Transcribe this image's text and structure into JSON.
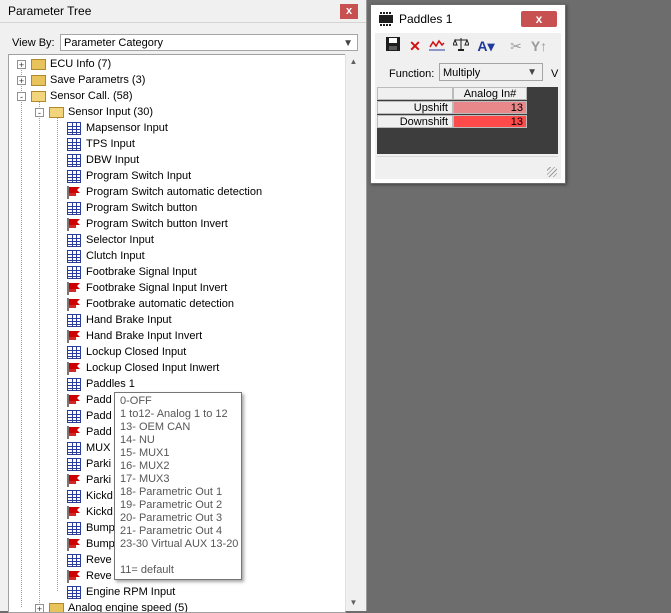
{
  "tree_panel": {
    "title": "Parameter Tree",
    "close_label": "x",
    "view_by_label": "View By:",
    "view_by_value": "Parameter Category",
    "items": [
      {
        "label": "ECU Info (7)",
        "icon": "folder-icon",
        "expander": "+"
      },
      {
        "label": "Save Parametrs (3)",
        "icon": "folder-icon",
        "expander": "+"
      },
      {
        "label": "Sensor Call. (58)",
        "icon": "folder-open-icon",
        "expander": "-"
      },
      {
        "label": "Sensor Input (30)",
        "icon": "folder-open-icon",
        "expander": "-"
      },
      {
        "label": "Mapsensor Input",
        "icon": "grid-icon"
      },
      {
        "label": "TPS Input",
        "icon": "grid-icon"
      },
      {
        "label": "DBW Input",
        "icon": "grid-icon"
      },
      {
        "label": "Program Switch Input",
        "icon": "grid-icon"
      },
      {
        "label": "Program Switch automatic detection",
        "icon": "flag-icon"
      },
      {
        "label": "Program Switch button",
        "icon": "grid-icon"
      },
      {
        "label": "Program Switch button Invert",
        "icon": "flag-icon"
      },
      {
        "label": "Selector Input",
        "icon": "grid-icon"
      },
      {
        "label": "Clutch Input",
        "icon": "grid-icon"
      },
      {
        "label": "Footbrake Signal Input",
        "icon": "grid-icon"
      },
      {
        "label": "Footbrake Signal Input Invert",
        "icon": "flag-icon"
      },
      {
        "label": "Footbrake automatic detection",
        "icon": "flag-icon"
      },
      {
        "label": "Hand Brake Input",
        "icon": "grid-icon"
      },
      {
        "label": "Hand Brake Input Invert",
        "icon": "flag-icon"
      },
      {
        "label": "Lockup Closed Input",
        "icon": "grid-icon"
      },
      {
        "label": "Lockup Closed Input Inwert",
        "icon": "flag-icon"
      },
      {
        "label": "Paddles 1",
        "icon": "grid-icon"
      },
      {
        "label": "Padd",
        "icon": "flag-icon"
      },
      {
        "label": "Padd",
        "icon": "grid-icon"
      },
      {
        "label": "Padd",
        "icon": "flag-icon"
      },
      {
        "label": "MUX",
        "icon": "grid-icon"
      },
      {
        "label": "Parki",
        "icon": "grid-icon"
      },
      {
        "label": "Parki",
        "icon": "flag-icon"
      },
      {
        "label": "Kickd",
        "icon": "grid-icon"
      },
      {
        "label": "Kickd",
        "icon": "flag-icon"
      },
      {
        "label": "Bump",
        "icon": "grid-icon"
      },
      {
        "label": "Bump",
        "icon": "flag-icon"
      },
      {
        "label": "Reve",
        "icon": "grid-icon"
      },
      {
        "label": "Reve",
        "icon": "flag-icon"
      },
      {
        "label": "Engine RPM Input",
        "icon": "grid-icon"
      },
      {
        "label": "Analog engine speed (5)",
        "icon": "folder-icon",
        "expander": "+"
      }
    ]
  },
  "tooltip": {
    "lines": [
      "0-OFF",
      "1 to12- Analog 1 to 12",
      "13- OEM CAN",
      "14- NU",
      "15- MUX1",
      "16- MUX2",
      "17- MUX3",
      "18- Parametric Out 1",
      "19- Parametric Out 2",
      "20- Parametric Out 3",
      "21- Parametric Out 4",
      "23-30 Virtual AUX 13-20",
      "",
      "11= default"
    ]
  },
  "paddles_window": {
    "title": "Paddles 1",
    "close_label": "x",
    "toolbar": [
      "save-icon",
      "delete-icon",
      "graph-icon",
      "balance-icon",
      "text-format-icon",
      "cut-icon",
      "merge-icon"
    ],
    "function_label": "Function:",
    "function_value": "Multiply",
    "function_extra": "V",
    "column_header": "Analog In#",
    "rows": [
      {
        "label": "Upshift",
        "value": "13",
        "color": "#e8888a"
      },
      {
        "label": "Downshift",
        "value": "13",
        "color": "#ff4a4a"
      }
    ]
  },
  "colors": {
    "desktop": "#6d6d6d",
    "close": "#c75050",
    "grid_icon": "#2a3c9c",
    "flag_icon": "#cc0000"
  }
}
